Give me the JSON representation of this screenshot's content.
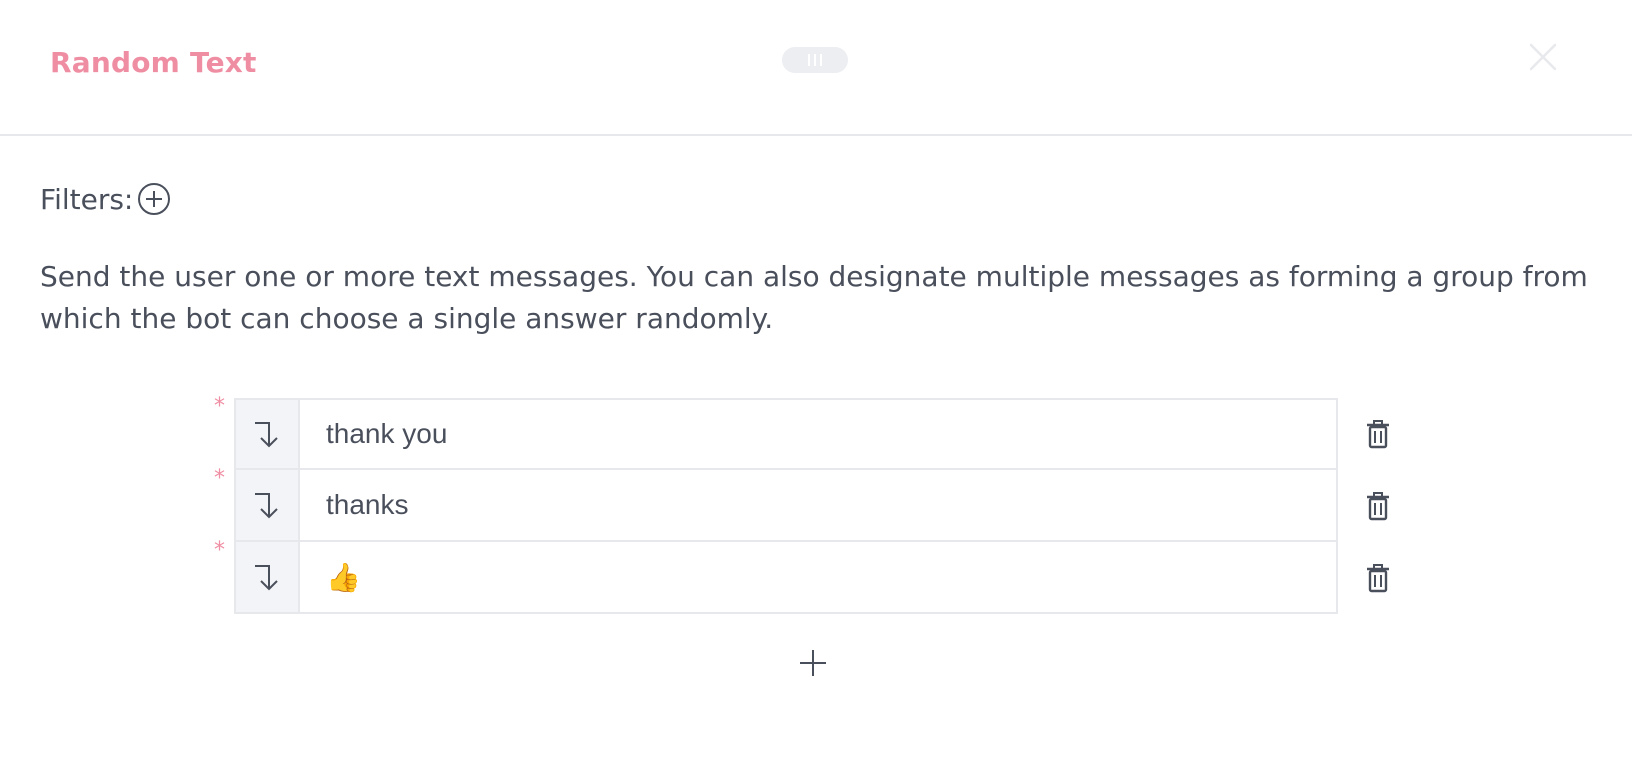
{
  "header": {
    "title": "Random Text",
    "drag_handle_icon": "drag-grip-icon",
    "close_icon": "close-icon",
    "accent_color": "#ef8ea3"
  },
  "filters": {
    "label": "Filters:",
    "add_icon": "plus-circle-icon"
  },
  "description": "Send the user one or more text messages. You can also designate multiple messages as forming a group from which the bot can choose a single answer randomly.",
  "messages": {
    "required_marker": "*",
    "row_icon": "arrow-turn-down-icon",
    "delete_icon": "trash-icon",
    "items": [
      {
        "value": "thank you"
      },
      {
        "value": "thanks"
      },
      {
        "value": "👍"
      }
    ],
    "add_icon": "plus-icon"
  }
}
